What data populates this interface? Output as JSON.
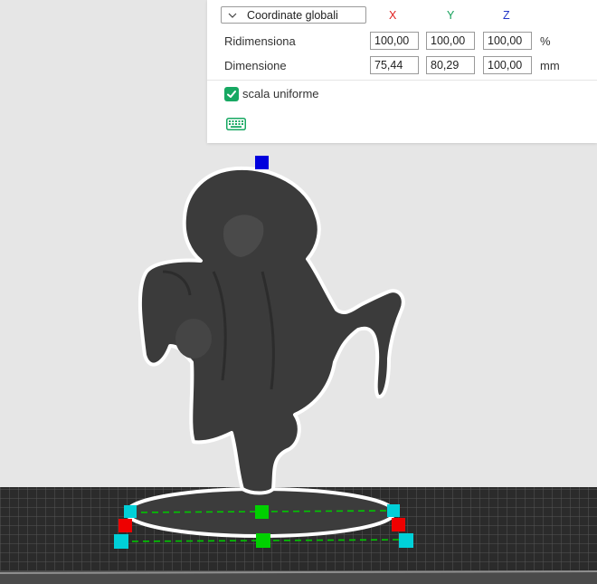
{
  "panel": {
    "coordinate_mode": "Coordinate globali",
    "axes": {
      "x": "X",
      "y": "Y",
      "z": "Z"
    },
    "resize": {
      "label": "Ridimensiona",
      "x": "100,00",
      "y": "100,00",
      "z": "100,00",
      "unit": "%"
    },
    "dimension": {
      "label": "Dimensione",
      "x": "75,44",
      "y": "80,29",
      "z": "100,00",
      "unit": "mm"
    },
    "uniform_scale": {
      "label": "scala uniforme",
      "checked": true
    }
  },
  "colors": {
    "accent_green": "#17a862",
    "axis_x": "#e02020",
    "axis_y": "#15a05a",
    "axis_z": "#2236c8",
    "handle_blue": "#0000dd",
    "handle_red": "#ee0000",
    "handle_green": "#00d000",
    "handle_cyan": "#00d0d8",
    "model": "#3a3a3a",
    "plate": "#2a2a2a"
  },
  "icons": {
    "dropdown": "chevron-down-icon",
    "checkbox": "check-icon",
    "keyboard": "keyboard-icon"
  }
}
